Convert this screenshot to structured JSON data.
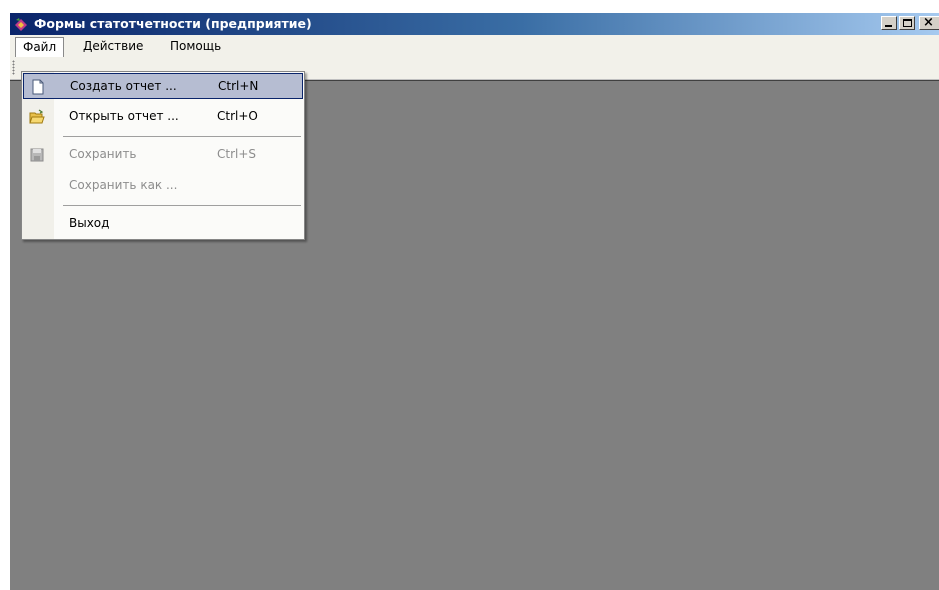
{
  "window": {
    "title": "Формы статотчетности (предприятие)"
  },
  "menubar": {
    "items": [
      {
        "label": "Файл"
      },
      {
        "label": "Действие"
      },
      {
        "label": "Помощь"
      }
    ]
  },
  "file_menu": {
    "items": [
      {
        "label": "Создать отчет ...",
        "shortcut": "Ctrl+N",
        "icon": "new-document-icon",
        "state": "highlighted"
      },
      {
        "label": "Открыть отчет ...",
        "shortcut": "Ctrl+O",
        "icon": "open-folder-icon",
        "state": "enabled"
      },
      {
        "label": "Сохранить",
        "shortcut": "Ctrl+S",
        "icon": "save-disk-icon",
        "state": "disabled"
      },
      {
        "label": "Сохранить как ...",
        "shortcut": "",
        "icon": "",
        "state": "disabled"
      },
      {
        "label": "Выход",
        "shortcut": "",
        "icon": "",
        "state": "enabled"
      }
    ]
  },
  "colors": {
    "client_background": "#808080",
    "highlight": "#b6bdd2",
    "title_gradient_start": "#0a246a",
    "title_gradient_end": "#a6caf0"
  }
}
